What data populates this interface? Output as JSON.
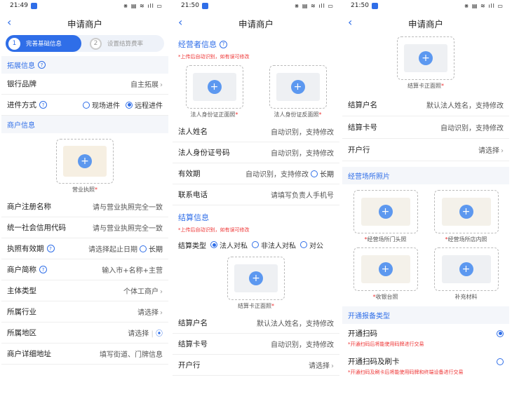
{
  "colors": {
    "accent": "#2f6ee8",
    "required": "#e33333"
  },
  "screen1": {
    "time": "21:49",
    "status_right": "⋇ ▤ ≋ ıll ▭",
    "title": "申请商户",
    "steps": [
      {
        "num": "1",
        "label": "完善基础信息"
      },
      {
        "num": "2",
        "label": "设置结算费率"
      }
    ],
    "expand_section": "拓展信息",
    "bank_brand_label": "银行品牌",
    "bank_brand_value": "自主拓展",
    "entry_label": "进件方式",
    "entry_opt1": "现场进件",
    "entry_opt2": "远程进件",
    "merchant_section": "商户信息",
    "license_caption": "营业执照",
    "rows": [
      {
        "label": "商户注册名称",
        "value": "请与营业执照完全一致"
      },
      {
        "label": "统一社会信用代码",
        "value": "请与营业执照完全一致"
      },
      {
        "label": "执照有效期",
        "value": "请选择起止日期",
        "extra": "长期"
      },
      {
        "label": "商户简称",
        "value": "输入市+名称+主营"
      },
      {
        "label": "主体类型",
        "value": "个体工商户"
      },
      {
        "label": "所属行业",
        "value": "请选择"
      },
      {
        "label": "所属地区",
        "value": "请选择"
      },
      {
        "label": "商户详细地址",
        "value": "填写街道、门牌信息"
      }
    ]
  },
  "screen2": {
    "time": "21:50",
    "status_right": "⋇ ▤ ≋ ıll ▭",
    "title": "申请商户",
    "operator_section": "经营者信息",
    "hint1": "*上传后自动识别，如有误可修改",
    "id_front": "法人身份证正面照",
    "id_back": "法人身份证反面照",
    "rows": [
      {
        "label": "法人姓名",
        "value": "自动识别，支持修改"
      },
      {
        "label": "法人身份证号码",
        "value": "自动识别，支持修改"
      },
      {
        "label": "有效期",
        "value": "自动识别，支持修改",
        "extra": "长期"
      },
      {
        "label": "联系电话",
        "value": "请填写负责人手机号"
      }
    ],
    "settle_section": "结算信息",
    "hint2": "*上传后自动识别，如有误可修改",
    "settle_type_label": "结算类型",
    "settle_opts": [
      "法人对私",
      "非法人对私",
      "对公"
    ],
    "card_caption": "结算卡正面照",
    "rows2": [
      {
        "label": "结算户名",
        "value": "默认法人姓名，支持修改"
      },
      {
        "label": "结算卡号",
        "value": "自动识别，支持修改"
      },
      {
        "label": "开户行",
        "value": "请选择"
      }
    ]
  },
  "screen3": {
    "time": "21:50",
    "status_right": "⋇ ▤ ≋ ıll ▭",
    "title": "申请商户",
    "card_caption": "结算卡正面照",
    "rows": [
      {
        "label": "结算户名",
        "value": "默认法人姓名，支持修改"
      },
      {
        "label": "结算卡号",
        "value": "自动识别，支持修改"
      },
      {
        "label": "开户行",
        "value": "请选择"
      }
    ],
    "venue_section": "经营场所照片",
    "photos": [
      "经营场所门头照",
      "经营场所店内照",
      "收银台照",
      "补充材料"
    ],
    "report_section": "开通报备类型",
    "open1_title": "开通扫码",
    "open1_sub": "*开通扫码后将能使用码牌进行交易",
    "open2_title": "开通扫码及刷卡",
    "open2_sub": "*开通扫码及刷卡后将能使用码牌和终端设备进行交易"
  }
}
